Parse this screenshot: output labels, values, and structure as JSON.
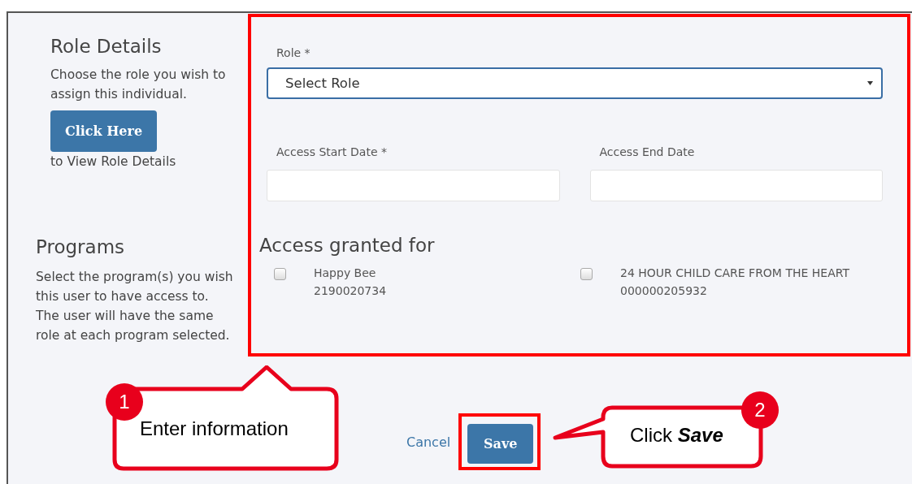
{
  "role_details": {
    "title": "Role Details",
    "description": "Choose the role you wish to assign this individual.",
    "button": "Click Here",
    "button_caption": "to View Role Details"
  },
  "programs": {
    "title": "Programs",
    "description": "Select the program(s) you wish this user to have access to. The user will have the same role at each program selected."
  },
  "form": {
    "role": {
      "label": "Role *",
      "value": "Select Role"
    },
    "start_date": {
      "label": "Access Start Date *"
    },
    "end_date": {
      "label": "Access End Date"
    },
    "access_title": "Access granted for",
    "programs": [
      {
        "name": "Happy Bee",
        "number": "2190020734",
        "checked": false
      },
      {
        "name": "24 HOUR CHILD CARE FROM THE HEART",
        "number": "000000205932",
        "checked": false
      }
    ]
  },
  "actions": {
    "cancel": "Cancel",
    "save": "Save"
  },
  "callouts": [
    {
      "number": "1",
      "text": "Enter information"
    },
    {
      "number": "2",
      "text": "Click **Save**"
    }
  ]
}
